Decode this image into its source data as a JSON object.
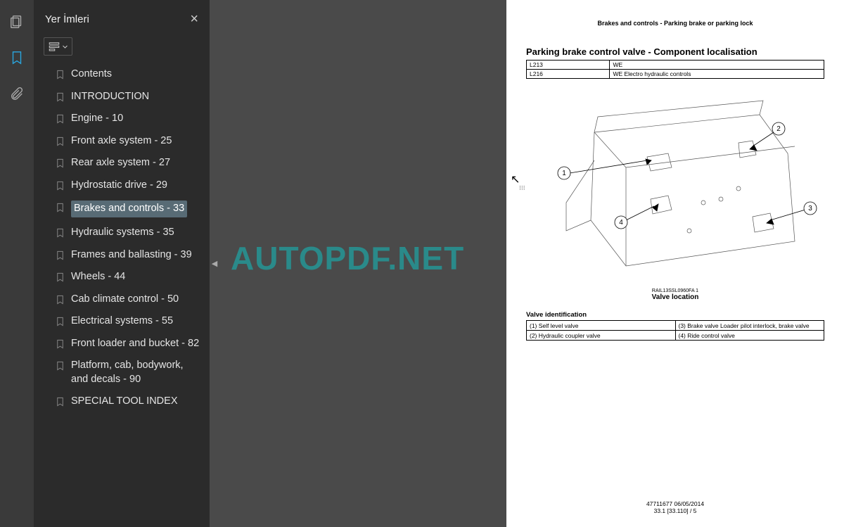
{
  "panel": {
    "title": "Yer İmleri"
  },
  "bookmarks": [
    {
      "label": "Contents",
      "selected": false
    },
    {
      "label": "INTRODUCTION",
      "selected": false
    },
    {
      "label": "Engine - 10",
      "selected": false
    },
    {
      "label": "Front axle system - 25",
      "selected": false
    },
    {
      "label": "Rear axle system - 27",
      "selected": false
    },
    {
      "label": "Hydrostatic drive - 29",
      "selected": false
    },
    {
      "label": "Brakes and controls - 33",
      "selected": true
    },
    {
      "label": "Hydraulic systems - 35",
      "selected": false
    },
    {
      "label": "Frames and ballasting - 39",
      "selected": false
    },
    {
      "label": "Wheels - 44",
      "selected": false
    },
    {
      "label": "Cab climate control - 50",
      "selected": false
    },
    {
      "label": "Electrical systems - 55",
      "selected": false
    },
    {
      "label": "Front loader and bucket - 82",
      "selected": false
    },
    {
      "label": "Platform, cab, bodywork, and decals - 90",
      "selected": false
    },
    {
      "label": "SPECIAL TOOL INDEX",
      "selected": false
    }
  ],
  "watermark": "AUTOPDF.NET",
  "doc": {
    "breadcrumb": "Brakes and controls - Parking brake or parking lock",
    "title": "Parking brake control valve - Component localisation",
    "models": [
      {
        "code": "L213",
        "desc": "WE"
      },
      {
        "code": "L216",
        "desc": "WE Electro hydraulic controls"
      }
    ],
    "diagram_ref": "RAIL13SSL0960FA   1",
    "diagram_caption": "Valve location",
    "legend_title": "Valve identification",
    "legend": [
      [
        "(1) Self level valve",
        "(3) Brake valve Loader pilot interlock, brake valve"
      ],
      [
        "(2) Hydraulic coupler valve",
        "(4) Ride control valve"
      ]
    ],
    "footer_line1": "47711677 06/05/2014",
    "footer_line2": "33.1 [33.110] / 5"
  },
  "callouts": [
    "1",
    "2",
    "3",
    "4"
  ]
}
